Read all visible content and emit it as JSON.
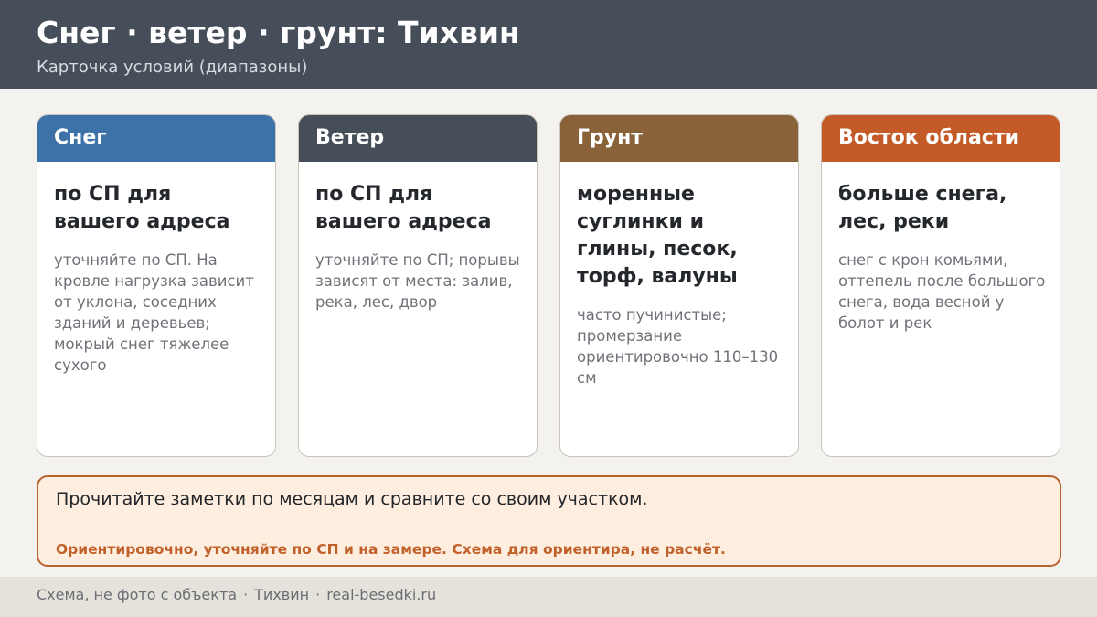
{
  "header": {
    "title": "Снег · ветер · грунт: Тихвин",
    "subtitle": "Карточка условий (диапазоны)"
  },
  "cards": [
    {
      "label": "Снег",
      "color": "#3c72a8",
      "title": "по СП для вашего адреса",
      "note": "уточняйте по СП. На кровле нагрузка зависит от уклона, соседних зданий и деревьев; мокрый снег тяжелее сухого"
    },
    {
      "label": "Ветер",
      "color": "#464e5a",
      "title": "по СП для вашего адреса",
      "note": "уточняйте по СП; порывы зависят от места: залив, река, лес, двор"
    },
    {
      "label": "Грунт",
      "color": "#8a6239",
      "title": "моренные суглинки и глины, песок, торф, валуны",
      "note": "часто пучинистые; промерзание ориентировочно 110–130 см"
    },
    {
      "label": "Восток области",
      "color": "#c45a27",
      "title": "больше снега, лес, реки",
      "note": "снег с крон комьями, оттепель после большого снега, вода весной у болот и рек"
    }
  ],
  "note": {
    "main": "Прочитайте заметки по месяцам и сравните со своим участком.",
    "warning": "Ориентировочно, уточняйте по СП и на замере. Схема для ориентира, не расчёт."
  },
  "footer": {
    "part1": "Схема, не фото с объекта",
    "part2": "Тихвин",
    "part3": "real-besedki.ru",
    "separator": "·"
  }
}
